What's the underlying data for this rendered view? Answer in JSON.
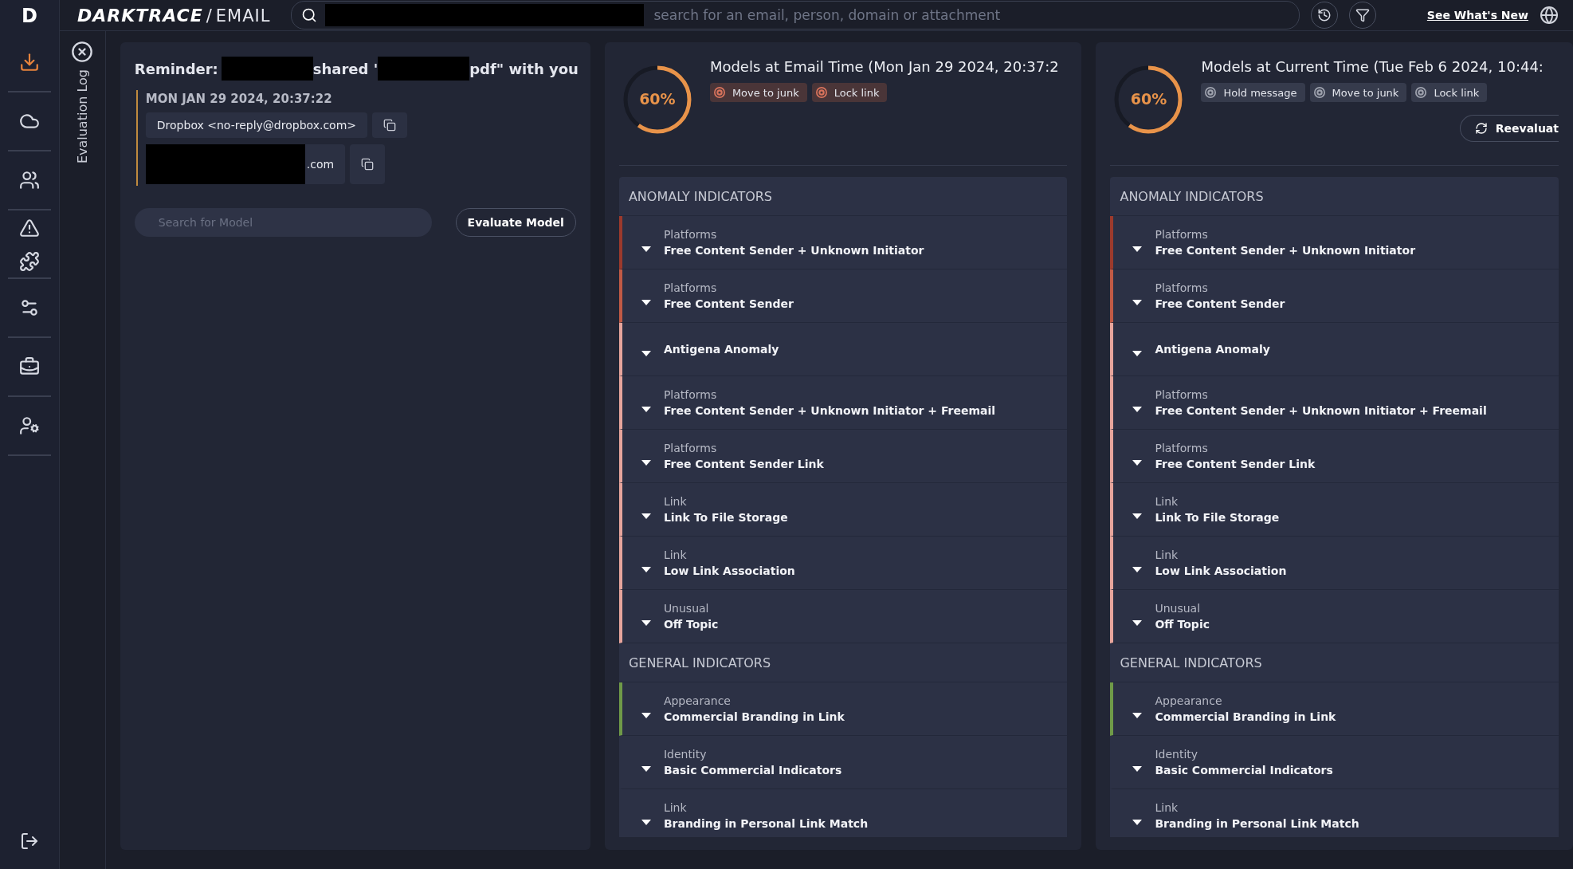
{
  "rail": {
    "logo": "D",
    "items": [
      {
        "selected": true
      },
      {
        "selected": false
      },
      {
        "selected": false
      },
      {
        "selected": false
      },
      {
        "selected": false
      },
      {
        "selected": false
      },
      {
        "selected": false
      },
      {
        "selected": false
      }
    ]
  },
  "topbar": {
    "brand": "DARKTRACE",
    "separator": "/",
    "product": "EMAIL",
    "search_placeholder": "search for an email, person, domain or attachment",
    "link": "See What's New"
  },
  "evaluation_log": {
    "label": "Evaluation Log"
  },
  "email": {
    "title_parts": [
      "Reminder:",
      "shared '",
      "pdf\" with you"
    ],
    "date": "MON JAN 29 2024, 20:37:22",
    "addresses": [
      {
        "text": "Dropbox <no-reply@dropbox.com>",
        "redacted": false
      },
      {
        "text": ".com",
        "redacted": true
      }
    ],
    "search_placeholder": "Search for Model",
    "evaluate_button": "Evaluate Model"
  },
  "panels": [
    {
      "title": "Models at Email Time (Mon Jan 29 2024, 20:37:2",
      "score": "60%",
      "level": 0.6,
      "actions": [
        {
          "label": "Move to junk",
          "active": true
        },
        {
          "label": "Lock link",
          "active": true
        }
      ],
      "sections": [
        {
          "heading": "ANOMALY INDICATORS",
          "rows": [
            {
              "category": "Platforms",
              "name": "Free Content Sender + Unknown Initiator",
              "color": "#9c3a2c"
            },
            {
              "category": "Platforms",
              "name": "Free Content Sender",
              "color": "#c15a45"
            },
            {
              "name": "Antigena Anomaly",
              "color": "#e7a59c"
            },
            {
              "category": "Platforms",
              "name": "Free Content Sender + Unknown Initiator + Freemail",
              "color": "#e7a59c"
            },
            {
              "category": "Platforms",
              "name": "Free Content Sender Link",
              "color": "#e7a59c"
            },
            {
              "category": "Link",
              "name": "Link To File Storage",
              "color": "#e7a59c"
            },
            {
              "category": "Link",
              "name": "Low Link Association",
              "color": "#e7a59c"
            },
            {
              "category": "Unusual",
              "name": "Off Topic",
              "color": "#e7a59c"
            }
          ]
        },
        {
          "heading": "GENERAL INDICATORS",
          "rows": [
            {
              "category": "Appearance",
              "name": "Commercial Branding in Link",
              "color": "#6f9a48"
            },
            {
              "category": "Identity",
              "name": "Basic Commercial Indicators"
            },
            {
              "category": "Link",
              "name": "Branding in Personal Link Match"
            }
          ]
        }
      ]
    },
    {
      "title": "Models at Current Time (Tue Feb 6 2024, 10:44:",
      "score": "60%",
      "level": 0.6,
      "actions": [
        {
          "label": "Hold message",
          "active": false
        },
        {
          "label": "Move to junk",
          "active": false
        },
        {
          "label": "Lock link",
          "active": false
        }
      ],
      "reevaluate": "Reevaluat",
      "sections": [
        {
          "heading": "ANOMALY INDICATORS",
          "rows": [
            {
              "category": "Platforms",
              "name": "Free Content Sender + Unknown Initiator",
              "color": "#9c3a2c"
            },
            {
              "category": "Platforms",
              "name": "Free Content Sender",
              "color": "#c15a45"
            },
            {
              "name": "Antigena Anomaly",
              "color": "#e7a59c"
            },
            {
              "category": "Platforms",
              "name": "Free Content Sender + Unknown Initiator + Freemail",
              "color": "#e7a59c"
            },
            {
              "category": "Platforms",
              "name": "Free Content Sender Link",
              "color": "#e7a59c"
            },
            {
              "category": "Link",
              "name": "Link To File Storage",
              "color": "#e7a59c"
            },
            {
              "category": "Link",
              "name": "Low Link Association",
              "color": "#e7a59c"
            },
            {
              "category": "Unusual",
              "name": "Off Topic",
              "color": "#e7a59c"
            }
          ]
        },
        {
          "heading": "GENERAL INDICATORS",
          "rows": [
            {
              "category": "Appearance",
              "name": "Commercial Branding in Link",
              "color": "#6f9a48"
            },
            {
              "category": "Identity",
              "name": "Basic Commercial Indicators"
            },
            {
              "category": "Link",
              "name": "Branding in Personal Link Match"
            }
          ]
        }
      ]
    }
  ]
}
